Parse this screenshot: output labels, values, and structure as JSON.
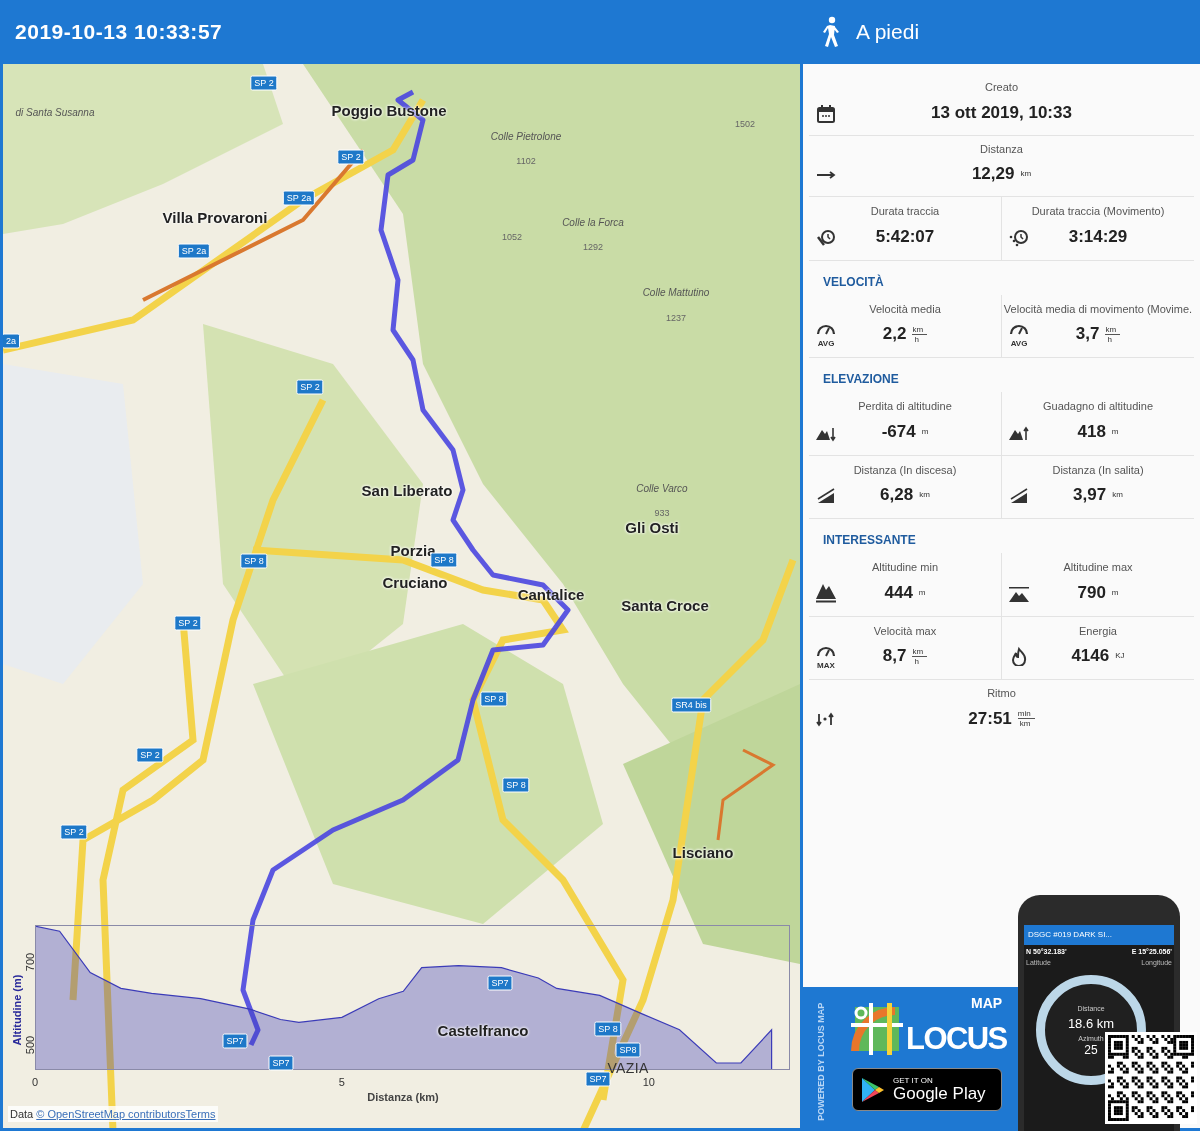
{
  "header": {
    "title": "2019-10-13 10:33:57",
    "activity": "A piedi"
  },
  "map": {
    "labels": [
      {
        "kind": "place",
        "text": "Poggio Bustone"
      },
      {
        "kind": "place",
        "text": "Villa Provaroni"
      },
      {
        "kind": "place",
        "text": "San Liberato"
      },
      {
        "kind": "place",
        "text": "Porzia"
      },
      {
        "kind": "place",
        "text": "Cruciano"
      },
      {
        "kind": "place",
        "text": "Cantalice"
      },
      {
        "kind": "place",
        "text": "Gli Osti"
      },
      {
        "kind": "place",
        "text": "Santa Croce"
      },
      {
        "kind": "place",
        "text": "Lisciano"
      },
      {
        "kind": "place",
        "text": "Castelfranco"
      },
      {
        "kind": "town",
        "text": "VAZIA"
      },
      {
        "kind": "peak",
        "text": "Colle Pietrolone"
      },
      {
        "kind": "peak",
        "text": "Colle la Forca"
      },
      {
        "kind": "peak",
        "text": "Colle Mattutino"
      },
      {
        "kind": "peak",
        "text": "Colle Varco"
      },
      {
        "kind": "peak",
        "text": "di Santa Susanna"
      },
      {
        "kind": "height",
        "text": "1502"
      },
      {
        "kind": "height",
        "text": "1102"
      },
      {
        "kind": "height",
        "text": "1052"
      },
      {
        "kind": "height",
        "text": "1292"
      },
      {
        "kind": "height",
        "text": "1237"
      },
      {
        "kind": "height",
        "text": "933"
      },
      {
        "kind": "road",
        "text": "SP 2"
      },
      {
        "kind": "road",
        "text": "SP 2"
      },
      {
        "kind": "road",
        "text": "SP 2a"
      },
      {
        "kind": "road",
        "text": "SP 2a"
      },
      {
        "kind": "road",
        "text": "2a"
      },
      {
        "kind": "road",
        "text": "SP 2"
      },
      {
        "kind": "road",
        "text": "SP 8"
      },
      {
        "kind": "road",
        "text": "SP 8"
      },
      {
        "kind": "road",
        "text": "SP 2"
      },
      {
        "kind": "road",
        "text": "SP 8"
      },
      {
        "kind": "road",
        "text": "SR4 bis"
      },
      {
        "kind": "road",
        "text": "SP 8"
      },
      {
        "kind": "road",
        "text": "SP 2"
      },
      {
        "kind": "road",
        "text": "SP 2"
      },
      {
        "kind": "road",
        "text": "SP7"
      },
      {
        "kind": "road",
        "text": "SP 8"
      },
      {
        "kind": "road",
        "text": "SP8"
      },
      {
        "kind": "road",
        "text": "SP7"
      },
      {
        "kind": "road",
        "text": "SP7"
      },
      {
        "kind": "road",
        "text": "SP7"
      }
    ],
    "profile": {
      "chart_data": {
        "type": "area",
        "xlabel": "Distanza (km)",
        "ylabel": "Altitudine (m)",
        "x": [
          0,
          0.4,
          0.9,
          1.4,
          1.9,
          2.7,
          3.5,
          4,
          4.3,
          5,
          5.6,
          6,
          6.3,
          6.9,
          7.6,
          8.2,
          8.5,
          9.2,
          9.9,
          10.5,
          11.1,
          11.5,
          12
        ],
        "series": [
          {
            "color": "#3b3bb8",
            "values": [
              787,
              775,
              675,
              637,
              625,
              612,
              587,
              562,
              555,
              567,
              612,
              630,
              687,
              692,
              687,
              662,
              637,
              620,
              575,
              537,
              457,
              457,
              537
            ]
          }
        ],
        "xlim": [
          0,
          12.3
        ],
        "ylim": [
          440,
          790
        ],
        "xticks": [
          0,
          5,
          10
        ],
        "yticks": [
          500,
          700
        ]
      }
    },
    "attribution": {
      "prefix": "Data",
      "link": "© OpenStreetMap contributors",
      "terms": "Terms"
    }
  },
  "stats": [
    {
      "kind": "row",
      "cells": [
        {
          "kind": "calendar",
          "label": "Creato",
          "value": "13 ott 2019, 10:33"
        }
      ]
    },
    {
      "kind": "row",
      "cells": [
        {
          "kind": "arrow",
          "label": "Distanza",
          "value": "12,29",
          "unit": "km"
        }
      ]
    },
    {
      "kind": "row",
      "cells": [
        {
          "kind": "stopwatch",
          "label": "Durata traccia",
          "value": "5:42:07"
        },
        {
          "kind": "stopwatch-dots",
          "label": "Durata traccia (Movimento)",
          "value": "3:14:29"
        }
      ]
    },
    {
      "kind": "heading",
      "text": "VELOCITÀ"
    },
    {
      "kind": "row",
      "cells": [
        {
          "kind": "gauge",
          "icon_text": "AVG",
          "label": "Velocità media",
          "value": "2,2",
          "unit": "km",
          "unit_per": "h"
        },
        {
          "kind": "gauge",
          "icon_text": "AVG",
          "label": "Velocità media di movimento (Movime.",
          "value": "3,7",
          "unit": "km",
          "unit_per": "h"
        }
      ]
    },
    {
      "kind": "heading",
      "text": "ELEVAZIONE"
    },
    {
      "kind": "row",
      "cells": [
        {
          "kind": "mountain-down",
          "label": "Perdita di altitudine",
          "value": "-674",
          "unit": "m"
        },
        {
          "kind": "mountain-up",
          "label": "Guadagno di altitudine",
          "value": "418",
          "unit": "m"
        }
      ]
    },
    {
      "kind": "row",
      "cells": [
        {
          "kind": "slope",
          "label": "Distanza (In discesa)",
          "value": "6,28",
          "unit": "km"
        },
        {
          "kind": "slope",
          "label": "Distanza (In salita)",
          "value": "3,97",
          "unit": "km"
        }
      ]
    },
    {
      "kind": "heading",
      "text": "INTERESSANTE"
    },
    {
      "kind": "row",
      "cells": [
        {
          "kind": "mountain",
          "label": "Altitudine min",
          "value": "444",
          "unit": "m"
        },
        {
          "kind": "mountain-top",
          "label": "Altitudine max",
          "value": "790",
          "unit": "m"
        }
      ]
    },
    {
      "kind": "row",
      "cells": [
        {
          "kind": "gauge",
          "icon_text": "MAX",
          "label": "Velocità max",
          "value": "8,7",
          "unit": "km",
          "unit_per": "h"
        },
        {
          "kind": "flame",
          "label": "Energia",
          "value": "4146",
          "unit": "KJ"
        }
      ]
    },
    {
      "kind": "row",
      "cells": [
        {
          "kind": "steps",
          "label": "Ritmo",
          "value": "27:51",
          "unit": "min",
          "unit_per": "km"
        }
      ]
    }
  ],
  "ad": {
    "side_text": "POWERED BY LOCUS MAP",
    "logo_small": "MAP",
    "logo_big": "LOCUS",
    "store_top": "GET IT ON",
    "store_name": "Google Play",
    "phone": {
      "title": "DSGC #019 DARK SI...",
      "lat": "N 50°32.183'",
      "lon": "E 15°25.056'",
      "lat_label": "Latitude",
      "lon_label": "Longitude",
      "distance_label": "Distance",
      "distance": "18.6 km",
      "azimuth_label": "Azimuth",
      "azimuth": "25"
    }
  }
}
